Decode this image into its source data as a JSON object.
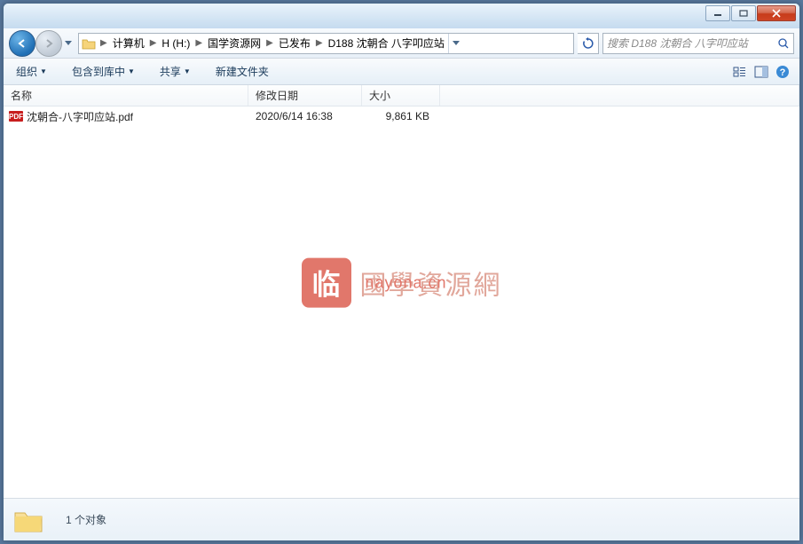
{
  "breadcrumb": {
    "items": [
      "计算机",
      "H (H:)",
      "国学资源网",
      "已发布",
      "D188 沈朝合 八字叩应站"
    ]
  },
  "search": {
    "placeholder": "搜索 D188 沈朝合 八字叩应站"
  },
  "toolbar": {
    "organize": "组织",
    "include": "包含到库中",
    "share": "共享",
    "newfolder": "新建文件夹"
  },
  "columns": {
    "name": "名称",
    "date": "修改日期",
    "size": "大小"
  },
  "files": [
    {
      "icon": "PDF",
      "name": "沈朝合-八字叩应站.pdf",
      "date": "2020/6/14 16:38",
      "size": "9,861 KB"
    }
  ],
  "watermark": {
    "badge": "临",
    "text": "國學資源網",
    "sub": "nayona.cn"
  },
  "status": {
    "count": "1 个对象"
  }
}
